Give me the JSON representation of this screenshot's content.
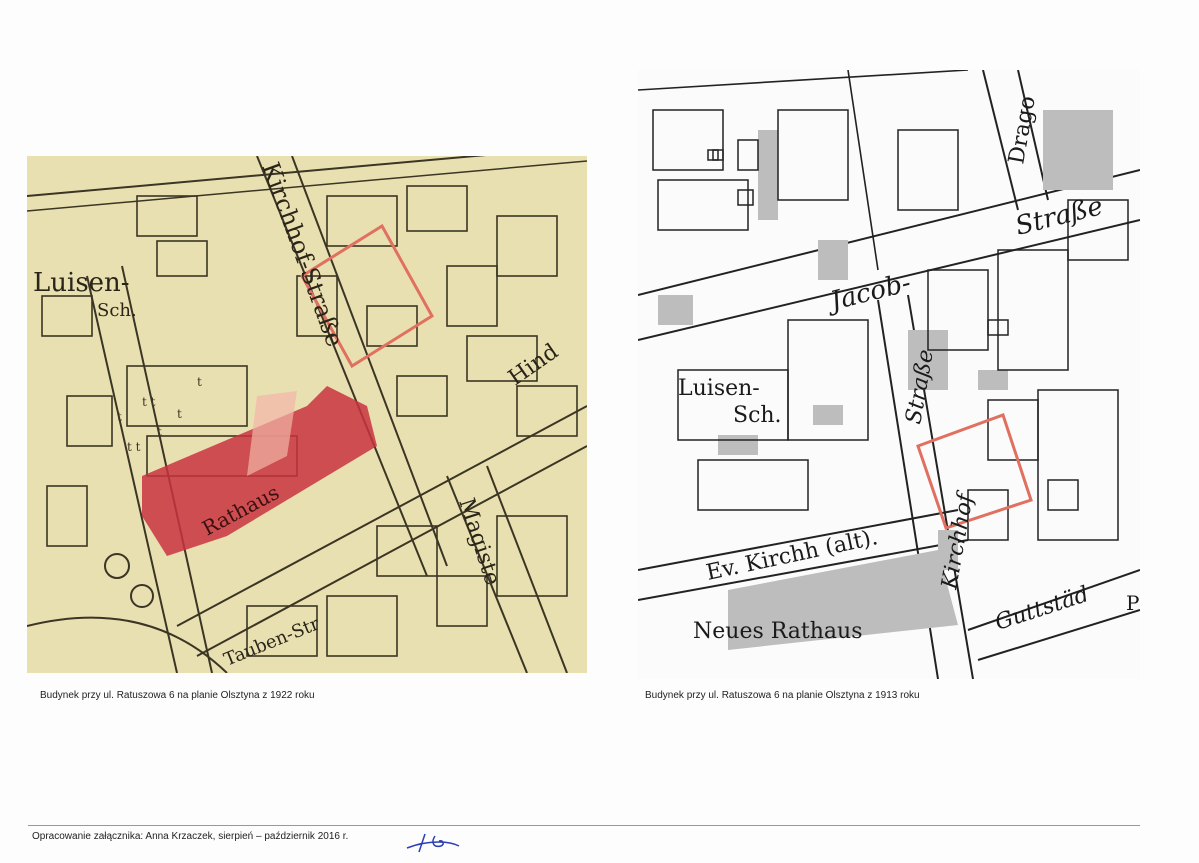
{
  "maps": {
    "map_1922": {
      "caption": "Budynek przy ul. Ratuszowa 6 na planie Olsztyna z 1922 roku",
      "labels": {
        "luisen": "Luisen-",
        "sch": "Sch.",
        "kirchhof_strasse": "Kirchhof-Straße",
        "rathaus": "Rathaus",
        "hindenburg": "Hind",
        "magisterstrasse": "Magiste",
        "tauben_str": "Tauben-Str"
      },
      "colors": {
        "paper": "#e8dfb4",
        "ink": "#3b3524",
        "highlight": "#e07060",
        "rathaus_fill": "#c8323f"
      }
    },
    "map_1913": {
      "caption": "Budynek przy ul. Ratuszowa 6 na planie Olsztyna z 1913 roku",
      "labels": {
        "dragoner": "Drago",
        "strasse_top": "Straße",
        "jacob": "Jacob-",
        "luisen": "Luisen-",
        "sch": "Sch.",
        "strasse_vertical": "Straße",
        "kirchhof": "Kirchhof",
        "ev_kirchh": "Ev. Kirchh (alt).",
        "neues_rathaus": "Neues Rathaus",
        "guttstaedter": "Guttstäd",
        "p": "P"
      },
      "colors": {
        "paper": "#fbfbfb",
        "ink": "#222222",
        "gray_fill": "#bdbdbd",
        "highlight": "#e07060"
      }
    }
  },
  "footer": {
    "text": "Opracowanie załącznika: Anna Krzaczek, sierpień – październik 2016 r."
  }
}
